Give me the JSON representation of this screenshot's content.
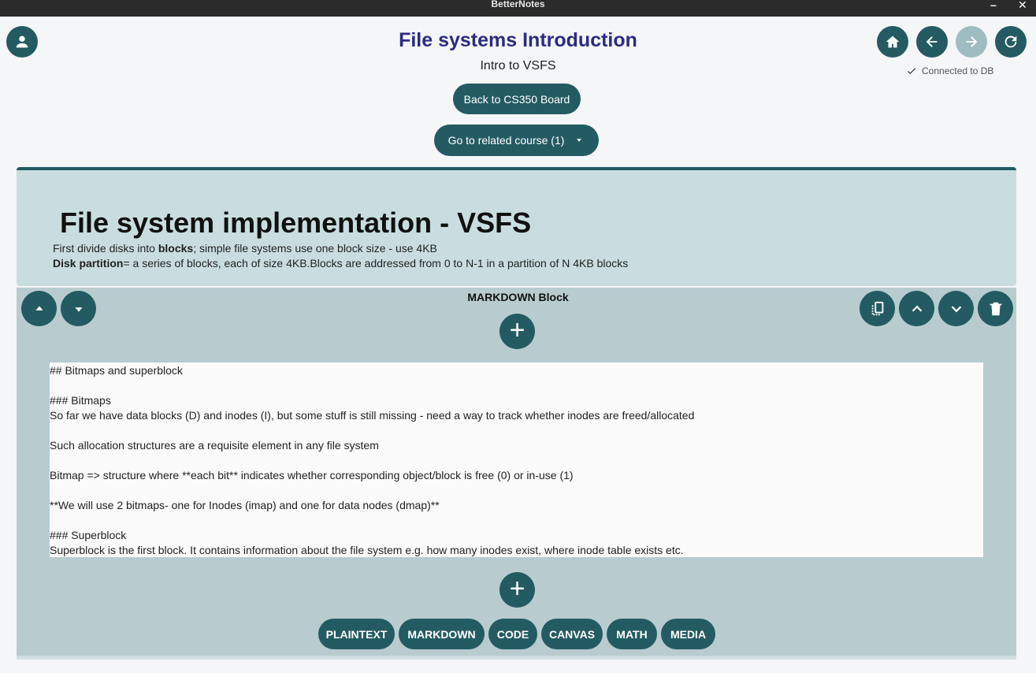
{
  "window": {
    "title": "BetterNotes",
    "minimize": "–",
    "close": "✕"
  },
  "page": {
    "title": "File systems Introduction",
    "subtitle": "Intro to VSFS"
  },
  "buttons": {
    "back_board": "Back to CS350 Board",
    "related_course": "Go to related course (1)"
  },
  "status": {
    "text": "Connected to DB"
  },
  "block1": {
    "heading": "File system implementation - VSFS",
    "line1_pre": "First divide disks into ",
    "line1_bold": "blocks",
    "line1_post": "; simple file systems use one block size - use 4KB",
    "line2_bold": "Disk partition",
    "line2_post": "= a series of blocks, each of size 4KB.Blocks are addressed from 0 to N-1 in a partition of N 4KB blocks"
  },
  "block2": {
    "label": "MARKDOWN Block",
    "lines": [
      "## Bitmaps and superblock",
      "",
      "### Bitmaps",
      "So far we have data blocks (D) and inodes (I), but some stuff is still missing - need a way to track whether inodes are freed/allocated",
      "",
      "Such allocation structures are a requisite element in any file system",
      "",
      "Bitmap => structure where **each bit** indicates whether corresponding object/block is free (0) or in-use (1)",
      "",
      "**We will use 2 bitmaps- one for Inodes (imap) and one for data nodes (dmap)**",
      "",
      "### Superblock",
      "Superblock is the first block. It contains information about the file system e.g. how many inodes exist, where inode table exists etc."
    ]
  },
  "block_types": [
    "PLAINTEXT",
    "MARKDOWN",
    "CODE",
    "CANVAS",
    "MATH",
    "MEDIA"
  ],
  "plus_symbol": "+",
  "colors": {
    "accent": "#245b62",
    "title": "#2c2c82",
    "panel_light": "#c9dde0",
    "panel_dark": "#b8ccd0"
  },
  "icons": [
    "person-icon",
    "home-icon",
    "arrow-left-icon",
    "arrow-right-icon",
    "refresh-icon",
    "check-icon",
    "caret-down-icon",
    "caret-up-icon",
    "copy-icon",
    "chevron-up-icon",
    "chevron-down-icon",
    "trash-icon",
    "plus-icon"
  ]
}
